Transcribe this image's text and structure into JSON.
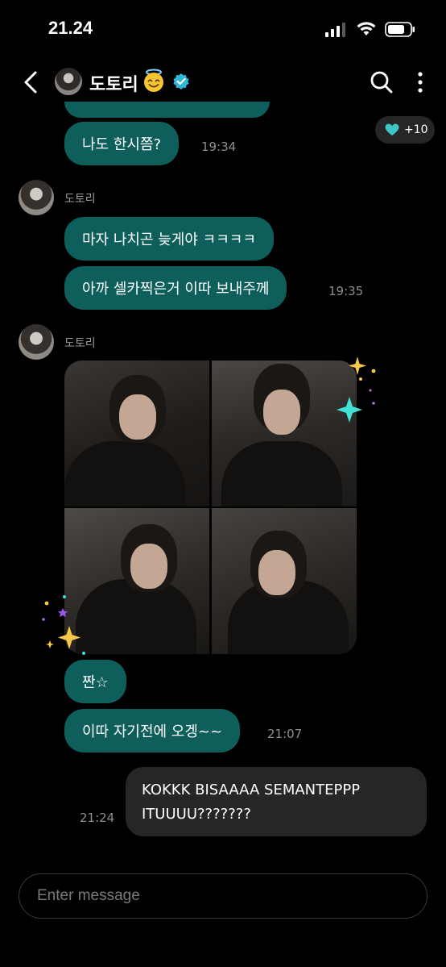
{
  "status_bar": {
    "time": "21.24",
    "icons": [
      "cellular-signal-icon",
      "wifi-icon",
      "battery-icon"
    ]
  },
  "header": {
    "title": "도토리",
    "emoji": "😇",
    "icons": [
      "back-arrow-icon",
      "verified-badge-icon",
      "search-icon",
      "more-vertical-icon"
    ]
  },
  "messages": [
    {
      "text": "나도 한시쯤?",
      "time": "19:34"
    },
    {
      "sender": "도토리",
      "text": "마자 나치곤 늦게야 ㅋㅋㅋㅋ"
    },
    {
      "text": "아까 셀카찍은거 이따 보내주께",
      "time": "19:35"
    },
    {
      "sender": "도토리",
      "type": "photo-grid",
      "photo_count": 4
    },
    {
      "text": "짠☆"
    },
    {
      "text": "이따 자기전에 오겡~~",
      "time": "21:07"
    }
  ],
  "reaction": {
    "icon": "heart-icon",
    "count": "+10"
  },
  "outgoing": {
    "text": "KOKKK BISAAAA SEMANTEPPP\nITUUUU???????",
    "time": "21:24"
  },
  "input": {
    "placeholder": "Enter message"
  },
  "colors": {
    "background": "#000000",
    "incoming_bubble": "#0e5f5b",
    "outgoing_bubble": "#262626",
    "accent": "#3ec6c6"
  }
}
